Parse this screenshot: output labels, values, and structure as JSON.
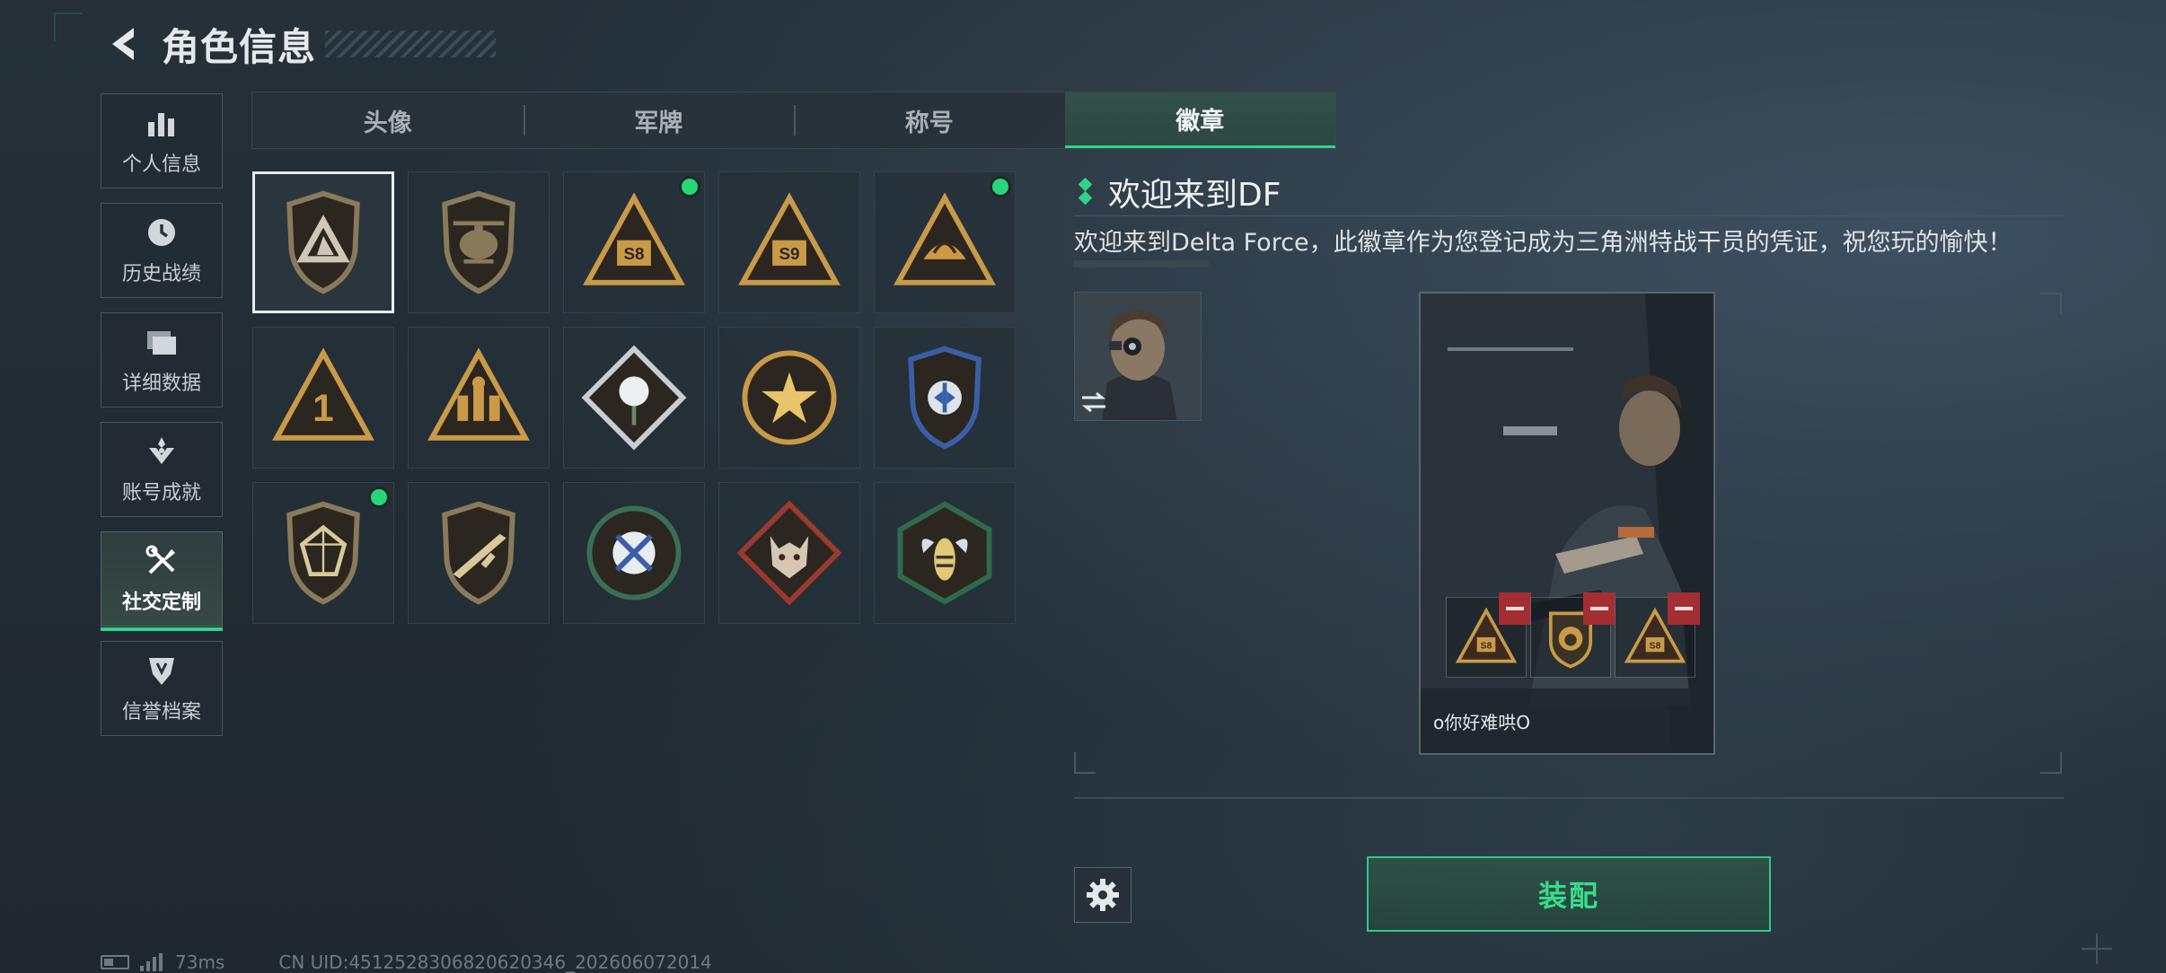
{
  "header": {
    "title": "角色信息",
    "back_icon": "back-arrow-icon"
  },
  "sidebar": {
    "items": [
      {
        "label": "个人信息",
        "icon": "bar-chart-icon",
        "active": false
      },
      {
        "label": "历史战绩",
        "icon": "clock-history-icon",
        "active": false
      },
      {
        "label": "详细数据",
        "icon": "folder-icon",
        "active": false
      },
      {
        "label": "账号成就",
        "icon": "achievement-icon",
        "active": false
      },
      {
        "label": "社交定制",
        "icon": "tools-icon",
        "active": true
      },
      {
        "label": "信誉档案",
        "icon": "shield-credit-icon",
        "active": false
      }
    ]
  },
  "tabs": [
    {
      "label": "头像",
      "active": false
    },
    {
      "label": "军牌",
      "active": false
    },
    {
      "label": "称号",
      "active": false
    },
    {
      "label": "徽章",
      "active": true
    }
  ],
  "badges": [
    {
      "name": "delta-force-badge",
      "selected": true,
      "new": false,
      "shape": "shield",
      "color": "#8a7a5c",
      "glyph": "triangle"
    },
    {
      "name": "helicopter-badge",
      "selected": false,
      "new": false,
      "shape": "shield",
      "color": "#8a7a5c",
      "glyph": "heli"
    },
    {
      "name": "s8-badge",
      "selected": false,
      "new": true,
      "shape": "triangle",
      "color": "#c99a48",
      "text": "S8"
    },
    {
      "name": "s9-badge",
      "selected": false,
      "new": false,
      "shape": "triangle",
      "color": "#c99a48",
      "text": "S9"
    },
    {
      "name": "lotus-badge",
      "selected": false,
      "new": true,
      "shape": "triangle",
      "color": "#c99a48",
      "glyph": "lotus"
    },
    {
      "name": "number-one-badge",
      "selected": false,
      "new": false,
      "shape": "triangle",
      "color": "#c99a48",
      "text": "1"
    },
    {
      "name": "squad-badge",
      "selected": false,
      "new": false,
      "shape": "triangle",
      "color": "#c99a48",
      "glyph": "squad"
    },
    {
      "name": "rose-badge",
      "selected": false,
      "new": false,
      "shape": "diamond",
      "color": "#c9ccd0",
      "glyph": "rose"
    },
    {
      "name": "star-medal-badge",
      "selected": false,
      "new": false,
      "shape": "circle",
      "color": "#c99a48",
      "glyph": "star"
    },
    {
      "name": "blue-shield-badge",
      "selected": false,
      "new": false,
      "shape": "shield",
      "color": "#3a5fa8",
      "glyph": "wings"
    },
    {
      "name": "gem-badge",
      "selected": false,
      "new": true,
      "shape": "shield",
      "color": "#8a7a5c",
      "glyph": "gem"
    },
    {
      "name": "rifle-badge",
      "selected": false,
      "new": false,
      "shape": "shield",
      "color": "#8a7a5c",
      "glyph": "rifle"
    },
    {
      "name": "crossed-knives-badge",
      "selected": false,
      "new": false,
      "shape": "circle",
      "color": "#3a6f55",
      "glyph": "knives"
    },
    {
      "name": "wolf-badge",
      "selected": false,
      "new": false,
      "shape": "diamond",
      "color": "#9a3a2e",
      "glyph": "wolf"
    },
    {
      "name": "wasp-badge",
      "selected": false,
      "new": false,
      "shape": "hexagon",
      "color": "#2f6a4a",
      "glyph": "wasp"
    }
  ],
  "detail": {
    "title": "欢迎来到DF",
    "description": "欢迎来到Delta Force，此徽章作为您登记成为三角洲特战干员的凭证，祝您玩的愉快！"
  },
  "preview": {
    "player_name": "o你好难哄O",
    "slots": [
      {
        "name": "slot-1",
        "glyph": "S8"
      },
      {
        "name": "slot-2",
        "glyph": "lion"
      },
      {
        "name": "slot-3",
        "glyph": "S8"
      }
    ]
  },
  "actions": {
    "equip_label": "装配",
    "settings_icon": "gear-icon"
  },
  "status": {
    "ping": "73ms",
    "uid": "CN UID:4512528306820620346_202606072014"
  },
  "colors": {
    "accent": "#2fd38a",
    "new_dot": "#27d67b",
    "remove": "#a32e33"
  }
}
